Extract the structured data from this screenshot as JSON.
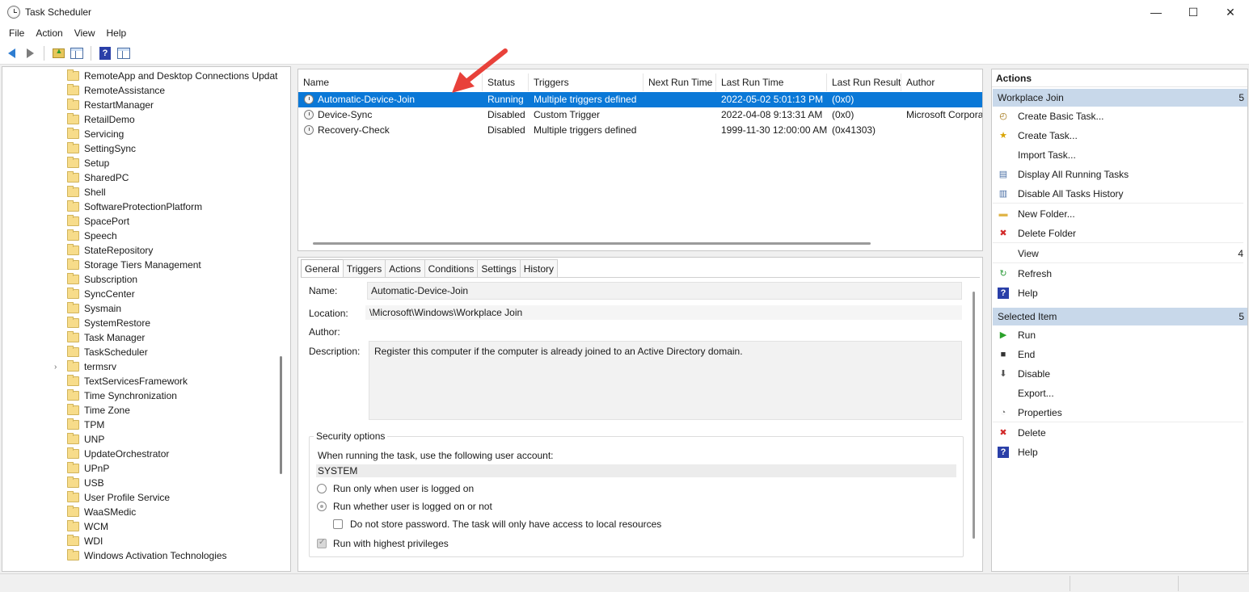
{
  "window": {
    "title": "Task Scheduler"
  },
  "menu": [
    "File",
    "Action",
    "View",
    "Help"
  ],
  "toolbar": {
    "icons": [
      "back-arrow-icon",
      "forward-arrow-icon",
      "folder-up-icon",
      "show-hide-pane-icon",
      "help-icon",
      "properties-pane-icon"
    ]
  },
  "tree": {
    "items": [
      {
        "label": "RemoteApp and Desktop Connections Updat",
        "expandable": false
      },
      {
        "label": "RemoteAssistance",
        "expandable": false
      },
      {
        "label": "RestartManager",
        "expandable": false
      },
      {
        "label": "RetailDemo",
        "expandable": false
      },
      {
        "label": "Servicing",
        "expandable": false
      },
      {
        "label": "SettingSync",
        "expandable": false
      },
      {
        "label": "Setup",
        "expandable": false
      },
      {
        "label": "SharedPC",
        "expandable": false
      },
      {
        "label": "Shell",
        "expandable": false
      },
      {
        "label": "SoftwareProtectionPlatform",
        "expandable": false
      },
      {
        "label": "SpacePort",
        "expandable": false
      },
      {
        "label": "Speech",
        "expandable": false
      },
      {
        "label": "StateRepository",
        "expandable": false
      },
      {
        "label": "Storage Tiers Management",
        "expandable": false
      },
      {
        "label": "Subscription",
        "expandable": false
      },
      {
        "label": "SyncCenter",
        "expandable": false
      },
      {
        "label": "Sysmain",
        "expandable": false
      },
      {
        "label": "SystemRestore",
        "expandable": false
      },
      {
        "label": "Task Manager",
        "expandable": false
      },
      {
        "label": "TaskScheduler",
        "expandable": false
      },
      {
        "label": "termsrv",
        "expandable": true
      },
      {
        "label": "TextServicesFramework",
        "expandable": false
      },
      {
        "label": "Time Synchronization",
        "expandable": false
      },
      {
        "label": "Time Zone",
        "expandable": false
      },
      {
        "label": "TPM",
        "expandable": false
      },
      {
        "label": "UNP",
        "expandable": false
      },
      {
        "label": "UpdateOrchestrator",
        "expandable": false
      },
      {
        "label": "UPnP",
        "expandable": false
      },
      {
        "label": "USB",
        "expandable": false
      },
      {
        "label": "User Profile Service",
        "expandable": false
      },
      {
        "label": "WaaSMedic",
        "expandable": false
      },
      {
        "label": "WCM",
        "expandable": false
      },
      {
        "label": "WDI",
        "expandable": false
      },
      {
        "label": "Windows Activation Technologies",
        "expandable": false
      }
    ]
  },
  "task_list": {
    "columns": [
      "Name",
      "Status",
      "Triggers",
      "Next Run Time",
      "Last Run Time",
      "Last Run Result",
      "Author"
    ],
    "rows": [
      {
        "name": "Automatic-Device-Join",
        "status": "Running",
        "triggers": "Multiple triggers defined",
        "next_run": "",
        "last_run": "2022-05-02 5:01:13 PM",
        "result": "(0x0)",
        "author": "",
        "selected": true
      },
      {
        "name": "Device-Sync",
        "status": "Disabled",
        "triggers": "Custom Trigger",
        "next_run": "",
        "last_run": "2022-04-08 9:13:31 AM",
        "result": "(0x0)",
        "author": "Microsoft Corpora",
        "selected": false
      },
      {
        "name": "Recovery-Check",
        "status": "Disabled",
        "triggers": "Multiple triggers defined",
        "next_run": "",
        "last_run": "1999-11-30 12:00:00 AM",
        "result": "(0x41303)",
        "author": "",
        "selected": false
      }
    ]
  },
  "detail": {
    "tabs": [
      "General",
      "Triggers",
      "Actions",
      "Conditions",
      "Settings",
      "History"
    ],
    "active_tab": "General",
    "name_label": "Name:",
    "name_value": "Automatic-Device-Join",
    "location_label": "Location:",
    "location_value": "\\Microsoft\\Windows\\Workplace Join",
    "author_label": "Author:",
    "author_value": "",
    "description_label": "Description:",
    "description_value": "Register this computer if the computer is already joined to an Active Directory domain.",
    "security": {
      "title": "Security options",
      "account_prompt": "When running the task, use the following user account:",
      "account": "SYSTEM",
      "radio_logged_on": "Run only when user is logged on",
      "radio_whether": "Run whether user is logged on or not",
      "radio_selected": "radio_whether",
      "no_store_password": "Do not store password.  The task will only have access to local resources",
      "highest_privileges": "Run with highest privileges",
      "highest_checked": true
    }
  },
  "actions": {
    "title": "Actions",
    "sections": [
      {
        "header": "Workplace Join",
        "count": "5",
        "items": [
          {
            "label": "Create Basic Task...",
            "icon": "create-basic-task-icon"
          },
          {
            "label": "Create Task...",
            "icon": "create-task-icon"
          },
          {
            "label": "Import Task...",
            "icon": ""
          },
          {
            "label": "Display All Running Tasks",
            "icon": "running-tasks-icon"
          },
          {
            "label": "Disable All Tasks History",
            "icon": "tasks-history-icon"
          },
          {
            "label": "New Folder...",
            "icon": "new-folder-icon"
          },
          {
            "label": "Delete Folder",
            "icon": "delete-folder-icon"
          },
          {
            "label": "View",
            "icon": "",
            "count": "4"
          },
          {
            "label": "Refresh",
            "icon": "refresh-icon"
          },
          {
            "label": "Help",
            "icon": "help-icon"
          }
        ]
      },
      {
        "header": "Selected Item",
        "count": "5",
        "items": [
          {
            "label": "Run",
            "icon": "run-icon"
          },
          {
            "label": "End",
            "icon": "end-icon"
          },
          {
            "label": "Disable",
            "icon": "disable-icon"
          },
          {
            "label": "Export...",
            "icon": ""
          },
          {
            "label": "Properties",
            "icon": "properties-icon"
          },
          {
            "label": "Delete",
            "icon": "delete-icon"
          },
          {
            "label": "Help",
            "icon": "help-icon"
          }
        ]
      }
    ]
  },
  "colors": {
    "selection": "#0a78d7",
    "section_header": "#c8d8ea",
    "annotation_arrow": "#e8413a"
  }
}
